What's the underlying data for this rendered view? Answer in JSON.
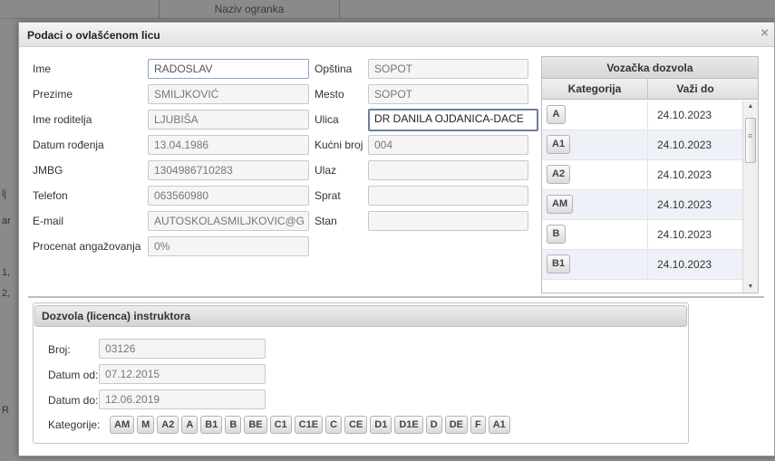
{
  "background": {
    "column_header": "Naziv ogranka",
    "left_stubs": [
      "lj",
      "ar",
      "1,",
      "2,",
      "R"
    ]
  },
  "modal": {
    "title": "Podaci o ovlašćenom licu",
    "close_icon": "×"
  },
  "person": {
    "ime": {
      "label": "Ime",
      "value": "RADOSLAV"
    },
    "prezime": {
      "label": "Prezime",
      "value": "SMILJKOVIĆ"
    },
    "ime_roditelja": {
      "label": "Ime roditelja",
      "value": "LJUBIŠA"
    },
    "datum_rodjenja": {
      "label": "Datum rođenja",
      "value": "13.04.1986"
    },
    "jmbg": {
      "label": "JMBG",
      "value": "1304986710283"
    },
    "telefon": {
      "label": "Telefon",
      "value": "063560980"
    },
    "email": {
      "label": "E-mail",
      "value": "AUTOSKOLASMILJKOVIC@G"
    },
    "angazovanje": {
      "label": "Procenat angažovanja",
      "value": "0%"
    }
  },
  "address": {
    "opstina": {
      "label": "Opština",
      "value": "SOPOT"
    },
    "mesto": {
      "label": "Mesto",
      "value": "SOPOT"
    },
    "ulica": {
      "label": "Ulica",
      "value": "DR DANILA OJDANICA-DACE"
    },
    "kucni_broj": {
      "label": "Kućni broj",
      "value": "004"
    },
    "ulaz": {
      "label": "Ulaz",
      "value": ""
    },
    "sprat": {
      "label": "Sprat",
      "value": ""
    },
    "stan": {
      "label": "Stan",
      "value": ""
    }
  },
  "vozacka": {
    "title": "Vozačka dozvola",
    "col_kategorija": "Kategorija",
    "col_vazi_do": "Važi do",
    "rows": [
      {
        "kat": "A",
        "do": "24.10.2023"
      },
      {
        "kat": "A1",
        "do": "24.10.2023"
      },
      {
        "kat": "A2",
        "do": "24.10.2023"
      },
      {
        "kat": "AM",
        "do": "24.10.2023"
      },
      {
        "kat": "B",
        "do": "24.10.2023"
      },
      {
        "kat": "B1",
        "do": "24.10.2023"
      }
    ]
  },
  "licenca": {
    "title": "Dozvola (licenca) instruktora",
    "broj": {
      "label": "Broj:",
      "value": "03126"
    },
    "datum_od": {
      "label": "Datum od:",
      "value": "07.12.2015"
    },
    "datum_do": {
      "label": "Datum do:",
      "value": "12.06.2019"
    },
    "kategorije_label": "Kategorije:",
    "kategorije": [
      "AM",
      "M",
      "A2",
      "A",
      "B1",
      "B",
      "BE",
      "C1",
      "C1E",
      "C",
      "CE",
      "D1",
      "D1E",
      "D",
      "DE",
      "F",
      "A1"
    ]
  }
}
